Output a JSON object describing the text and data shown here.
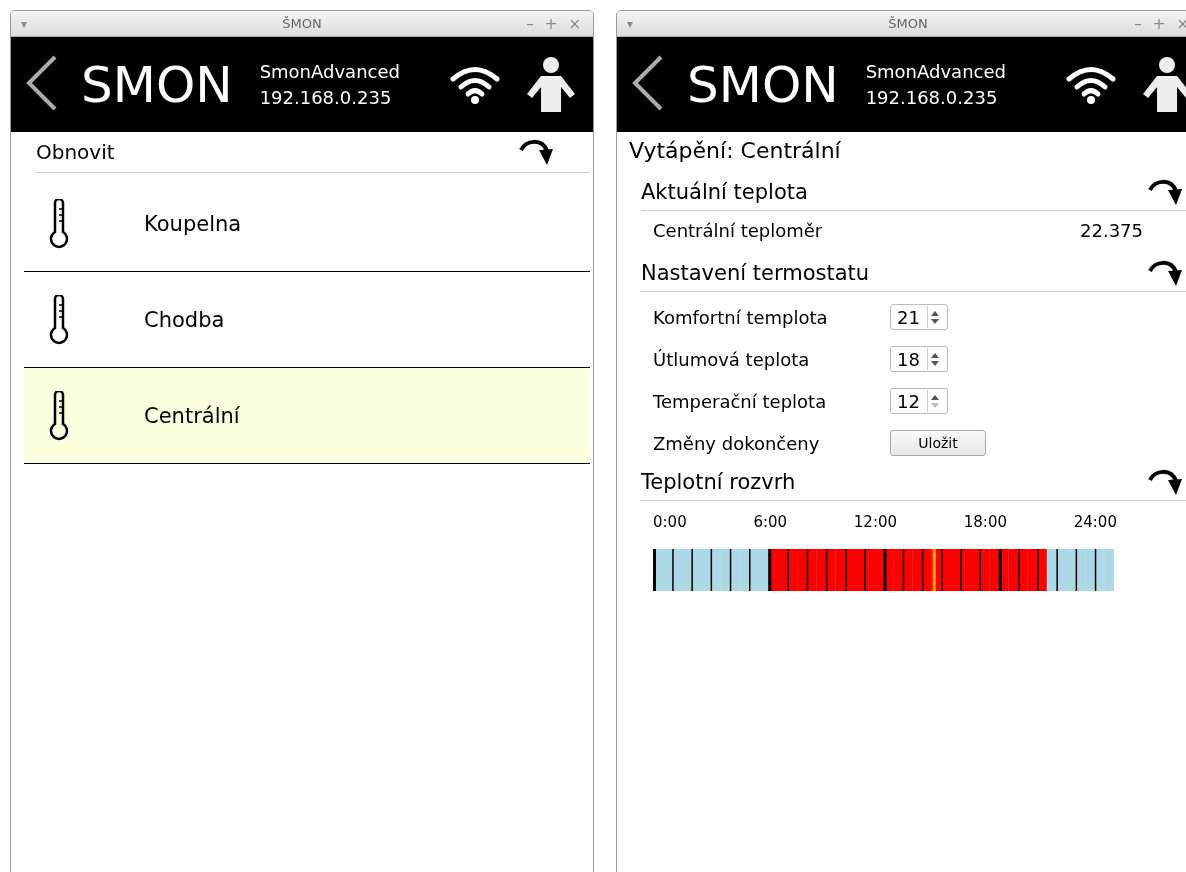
{
  "windows": [
    {
      "kind": "rooms",
      "title": "ŠMON",
      "menu_glyph": "▾",
      "controls": [
        "–",
        "+",
        "×"
      ],
      "header": {
        "logo": "SMON",
        "device": "SmonAdvanced",
        "address": "192.168.0.235"
      },
      "refresh_label": "Obnovit",
      "rooms": [
        {
          "name": "Koupelna",
          "selected": false
        },
        {
          "name": "Chodba",
          "selected": false
        },
        {
          "name": "Centrální",
          "selected": true
        }
      ]
    },
    {
      "kind": "detail",
      "title": "ŠMON",
      "menu_glyph": "▾",
      "controls": [
        "–",
        "+",
        "×"
      ],
      "header": {
        "logo": "SMON",
        "device": "SmonAdvanced",
        "address": "192.168.0.235"
      },
      "heading": "Vytápění: Centrální",
      "sections": [
        {
          "kind": "readings",
          "title": "Aktuální teplota",
          "rows": [
            {
              "label": "Centrální teploměr",
              "value": "22.375"
            }
          ]
        },
        {
          "kind": "settings",
          "title": "Nastavení termostatu",
          "rows": [
            {
              "kind": "spinner",
              "label": "Komfortní templota",
              "value": "21",
              "down_disabled": false
            },
            {
              "kind": "spinner",
              "label": "Útlumová teplota",
              "value": "18",
              "down_disabled": false
            },
            {
              "kind": "spinner",
              "label": "Temperační teplota",
              "value": "12",
              "down_disabled": true
            },
            {
              "kind": "button",
              "label": "Změny dokončeny",
              "button": "Uložit"
            }
          ]
        },
        {
          "kind": "schedule",
          "title": "Teplotní rozvrh",
          "ticks": [
            "0:00",
            "6:00",
            "12:00",
            "18:00",
            "24:00"
          ],
          "slots": [
            {
              "kind": "reduced"
            },
            {
              "kind": "reduced"
            },
            {
              "kind": "reduced"
            },
            {
              "kind": "reduced"
            },
            {
              "kind": "reduced"
            },
            {
              "kind": "reduced"
            },
            {
              "kind": "reduced"
            },
            {
              "kind": "reduced"
            },
            {
              "kind": "reduced"
            },
            {
              "kind": "reduced"
            },
            {
              "kind": "reduced"
            },
            {
              "kind": "reduced"
            },
            {
              "kind": "comfort"
            },
            {
              "kind": "comfort"
            },
            {
              "kind": "comfort"
            },
            {
              "kind": "comfort"
            },
            {
              "kind": "comfort"
            },
            {
              "kind": "comfort"
            },
            {
              "kind": "comfort"
            },
            {
              "kind": "comfort"
            },
            {
              "kind": "comfort"
            },
            {
              "kind": "comfort"
            },
            {
              "kind": "comfort"
            },
            {
              "kind": "comfort"
            },
            {
              "kind": "comfort"
            },
            {
              "kind": "comfort"
            },
            {
              "kind": "comfort"
            },
            {
              "kind": "comfort"
            },
            {
              "kind": "comfort"
            },
            {
              "kind": "comfort"
            },
            {
              "kind": "comfort"
            },
            {
              "kind": "comfort"
            },
            {
              "kind": "comfort"
            },
            {
              "kind": "comfort"
            },
            {
              "kind": "comfort"
            },
            {
              "kind": "comfort"
            },
            {
              "kind": "comfort"
            },
            {
              "kind": "comfort"
            },
            {
              "kind": "comfort"
            },
            {
              "kind": "comfort"
            },
            {
              "kind": "comfort"
            },
            {
              "kind": "reduced"
            },
            {
              "kind": "reduced"
            },
            {
              "kind": "reduced"
            },
            {
              "kind": "reduced"
            },
            {
              "kind": "reduced"
            },
            {
              "kind": "reduced"
            },
            {
              "kind": "reduced"
            }
          ],
          "marker": {
            "level": 0.607
          }
        }
      ]
    }
  ]
}
